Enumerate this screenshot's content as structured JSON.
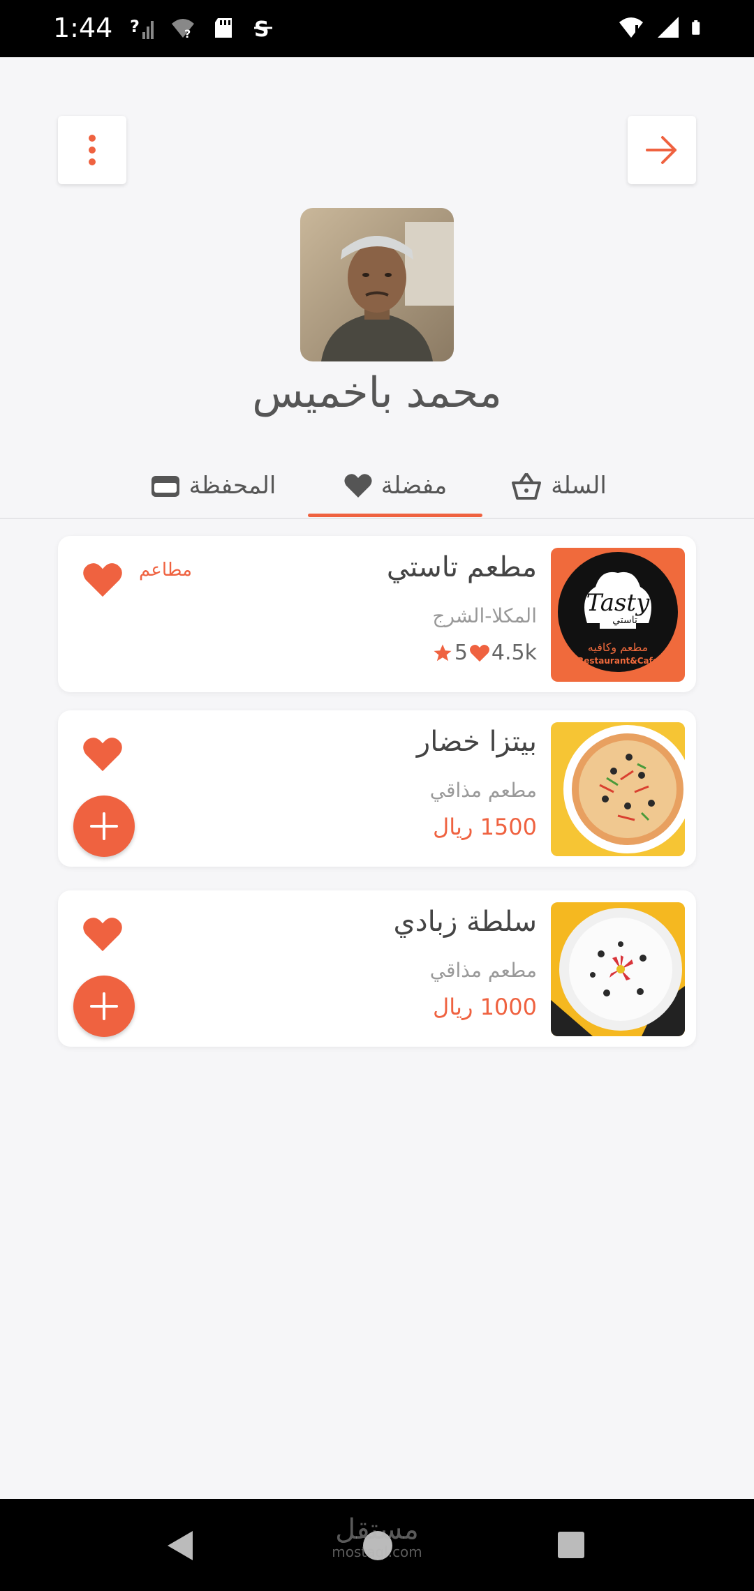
{
  "status_bar": {
    "time": "1:44"
  },
  "header": {
    "menu_icon": "more-vert-icon",
    "forward_icon": "arrow-right-icon"
  },
  "profile": {
    "name": "محمد باخميس"
  },
  "tabs": [
    {
      "label": "المحفظة",
      "icon": "wallet-icon"
    },
    {
      "label": "مفضلة",
      "icon": "heart-icon",
      "active": true
    },
    {
      "label": "السلة",
      "icon": "basket-icon"
    }
  ],
  "favorites": [
    {
      "title": "مطعم تاستي",
      "subtitle": "المكلا-الشرج",
      "tag": "مطاعم",
      "rating": "5",
      "likes": "4.5k",
      "logo_text": "Tasty",
      "logo_ar": "تاستي",
      "logo_caption_ar": "مطعم وكافيه",
      "logo_caption_en": "Restaurant&Cafe"
    },
    {
      "title": "بيتزا خضار",
      "subtitle": "مطعم مذاقي",
      "price": "1500 ريال"
    },
    {
      "title": "سلطة زبادي",
      "subtitle": "مطعم مذاقي",
      "price": "1000 ريال"
    }
  ],
  "colors": {
    "accent": "#ef6240",
    "background": "#f6f6f8"
  },
  "watermark": {
    "ar": "مستقل",
    "en": "mostaql.com"
  }
}
